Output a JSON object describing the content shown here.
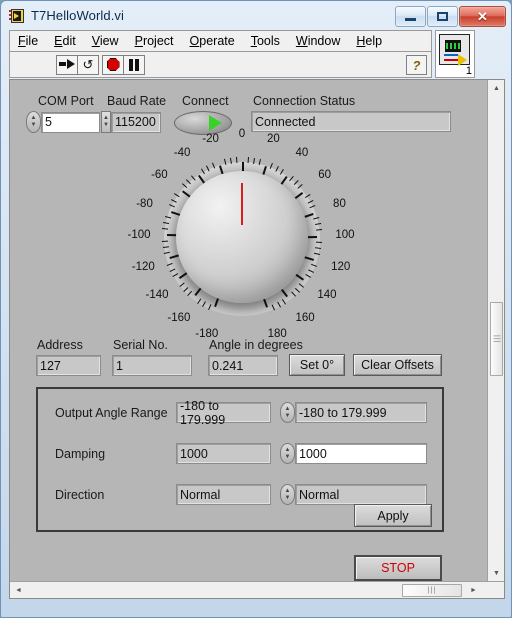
{
  "window": {
    "title": "T7HelloWorld.vi",
    "icon": "labview-vi-icon",
    "buttons": {
      "minimize": "minimize-button",
      "maximize": "maximize-button",
      "close": "close-button"
    }
  },
  "menu": {
    "items": [
      {
        "label": "File",
        "mnemonic": "F"
      },
      {
        "label": "Edit",
        "mnemonic": "E"
      },
      {
        "label": "View",
        "mnemonic": "V"
      },
      {
        "label": "Project",
        "mnemonic": "P"
      },
      {
        "label": "Operate",
        "mnemonic": "O"
      },
      {
        "label": "Tools",
        "mnemonic": "T"
      },
      {
        "label": "Window",
        "mnemonic": "W"
      },
      {
        "label": "Help",
        "mnemonic": "H"
      }
    ]
  },
  "toolbar": {
    "run": "run-icon",
    "run_continuously": "run-continuously-icon",
    "abort": "abort-execution-icon",
    "pause": "pause-icon",
    "help": "?",
    "vi_icon_number": "1"
  },
  "connection": {
    "com_port_label": "COM Port",
    "com_port_value": "5",
    "baud_rate_label": "Baud Rate",
    "baud_rate_value": "115200",
    "connect_label": "Connect",
    "connect_state": "on",
    "status_label": "Connection Status",
    "status_value": "Connected"
  },
  "dial": {
    "needle_value": 0,
    "needle_color": "#d81f1f",
    "tick_labels": [
      {
        "value": -180,
        "text": "-180"
      },
      {
        "value": -160,
        "text": "-160"
      },
      {
        "value": -140,
        "text": "-140"
      },
      {
        "value": -120,
        "text": "-120"
      },
      {
        "value": -100,
        "text": "-100"
      },
      {
        "value": -80,
        "text": "-80"
      },
      {
        "value": -60,
        "text": "-60"
      },
      {
        "value": -40,
        "text": "-40"
      },
      {
        "value": -20,
        "text": "-20"
      },
      {
        "value": 0,
        "text": "0"
      },
      {
        "value": 20,
        "text": "20"
      },
      {
        "value": 40,
        "text": "40"
      },
      {
        "value": 60,
        "text": "60"
      },
      {
        "value": 80,
        "text": "80"
      },
      {
        "value": 100,
        "text": "100"
      },
      {
        "value": 120,
        "text": "120"
      },
      {
        "value": 140,
        "text": "140"
      },
      {
        "value": 160,
        "text": "160"
      },
      {
        "value": 180,
        "text": "180"
      }
    ],
    "min": -180,
    "max": 180,
    "major_step": 20,
    "minor_step": 5
  },
  "readouts": {
    "address_label": "Address",
    "address_value": "127",
    "serial_label": "Serial No.",
    "serial_value": "1",
    "angle_label": "Angle in degrees",
    "angle_value": "0.241",
    "set_zero_label": "Set 0°",
    "clear_offsets_label": "Clear Offsets"
  },
  "settings": {
    "rows": [
      {
        "label": "Output Angle Range",
        "current": "-180 to 179.999",
        "selected": "-180 to 179.999",
        "editable": false
      },
      {
        "label": "Damping",
        "current": "1000",
        "selected": "1000",
        "editable": true
      },
      {
        "label": "Direction",
        "current": "Normal",
        "selected": "Normal",
        "editable": false
      }
    ],
    "apply_label": "Apply"
  },
  "stop": {
    "label": "STOP",
    "color": "#d00000"
  },
  "scrollbars": {
    "vertical_up": "▲",
    "vertical_down": "▼",
    "horizontal_left": "◄",
    "horizontal_right": "►",
    "grip": "|||"
  }
}
